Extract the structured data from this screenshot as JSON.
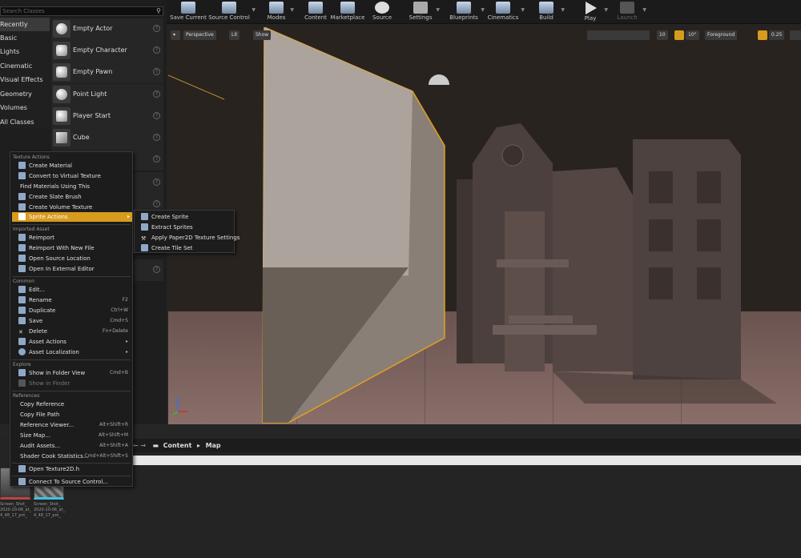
{
  "left_panel": {
    "search_placeholder": "Search Classes",
    "categories": [
      "Recently Placed",
      "Basic",
      "Lights",
      "Cinematic",
      "Visual Effects",
      "Geometry",
      "Volumes",
      "All Classes"
    ],
    "items": [
      "Empty Actor",
      "Empty Character",
      "Empty Pawn",
      "Point Light",
      "Player Start",
      "Cube"
    ]
  },
  "toolbar": {
    "buttons": [
      "Save Current",
      "Source Control",
      "Modes",
      "Content",
      "Marketplace",
      "Source",
      "Settings",
      "Blueprints",
      "Cinematics",
      "Build",
      "Play",
      "Launch"
    ]
  },
  "viewport": {
    "perspective": "Perspective",
    "lit": "Lit",
    "show": "Show",
    "grid_value": "10",
    "angle_value": "10°",
    "layer": "Foreground",
    "scale_value": "0.25"
  },
  "context_menu": {
    "sec_texture": "Texture Actions",
    "create_material": "Create Material",
    "convert_virtual": "Convert to Virtual Texture",
    "find_materials": "Find Materials Using This",
    "create_slate": "Create Slate Brush",
    "create_volume": "Create Volume Texture",
    "sprite_actions": "Sprite Actions",
    "sec_imported": "Imported Asset",
    "reimport": "Reimport",
    "reimport_new": "Reimport With New File",
    "open_source": "Open Source Location",
    "open_external": "Open In External Editor",
    "sec_common": "Common",
    "edit": "Edit...",
    "rename": "Rename",
    "rename_sc": "F2",
    "duplicate": "Duplicate",
    "duplicate_sc": "Ctrl+W",
    "save": "Save",
    "save_sc": "Cmd+S",
    "delete": "Delete",
    "delete_sc": "Fn+Delete",
    "asset_actions": "Asset Actions",
    "asset_localization": "Asset Localization",
    "sec_explore": "Explore",
    "show_folder": "Show in Folder View",
    "show_folder_sc": "Cmd+B",
    "show_finder": "Show in Finder",
    "sec_references": "References",
    "copy_reference": "Copy Reference",
    "copy_path": "Copy File Path",
    "ref_viewer": "Reference Viewer...",
    "ref_viewer_sc": "Alt+Shift+R",
    "size_map": "Size Map...",
    "size_map_sc": "Alt+Shift+M",
    "audit": "Audit Assets...",
    "audit_sc": "Alt+Shift+A",
    "shader_cook": "Shader Cook Statistics...",
    "shader_cook_sc": "Cmd+Alt+Shift+S",
    "open_texture2d": "Open Texture2D.h",
    "connect_source": "Connect To Source Control..."
  },
  "submenu": {
    "create_sprite": "Create Sprite",
    "extract_sprites": "Extract Sprites",
    "apply_paper2d": "Apply Paper2D Texture Settings",
    "create_tile_set": "Create Tile Set"
  },
  "content_browser": {
    "crumb_content": "Content",
    "crumb_map": "Map",
    "asset1_lines": [
      "Screen_Shot_",
      "2020-10-06_at_",
      "4_48_17_pm_"
    ],
    "asset2_lines": [
      "Screen_Shot_",
      "2020-10-06_at_",
      "4_48_17_pm_"
    ]
  },
  "colors": {
    "highlight": "#d79b1e",
    "selection_outline": "#e0a020"
  }
}
